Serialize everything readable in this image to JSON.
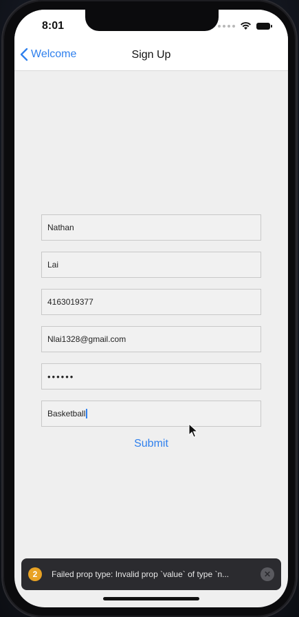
{
  "status_bar": {
    "time": "8:01",
    "icons": [
      "signal-icon",
      "wifi-icon",
      "battery-icon"
    ]
  },
  "nav": {
    "back_label": "Welcome",
    "title": "Sign Up"
  },
  "form": {
    "first_name": "Nathan",
    "last_name": "Lai",
    "phone": "4163019377",
    "email": "Nlai1328@gmail.com",
    "password": "••••••",
    "interest": "Basketball",
    "submit_label": "Submit"
  },
  "toast": {
    "count": "2",
    "message": "Failed prop type: Invalid prop `value` of type `n...",
    "close_icon": "close-icon"
  },
  "colors": {
    "accent": "#2f80ed",
    "badge": "#e8a224",
    "toast_bg": "#2b2b2f"
  }
}
